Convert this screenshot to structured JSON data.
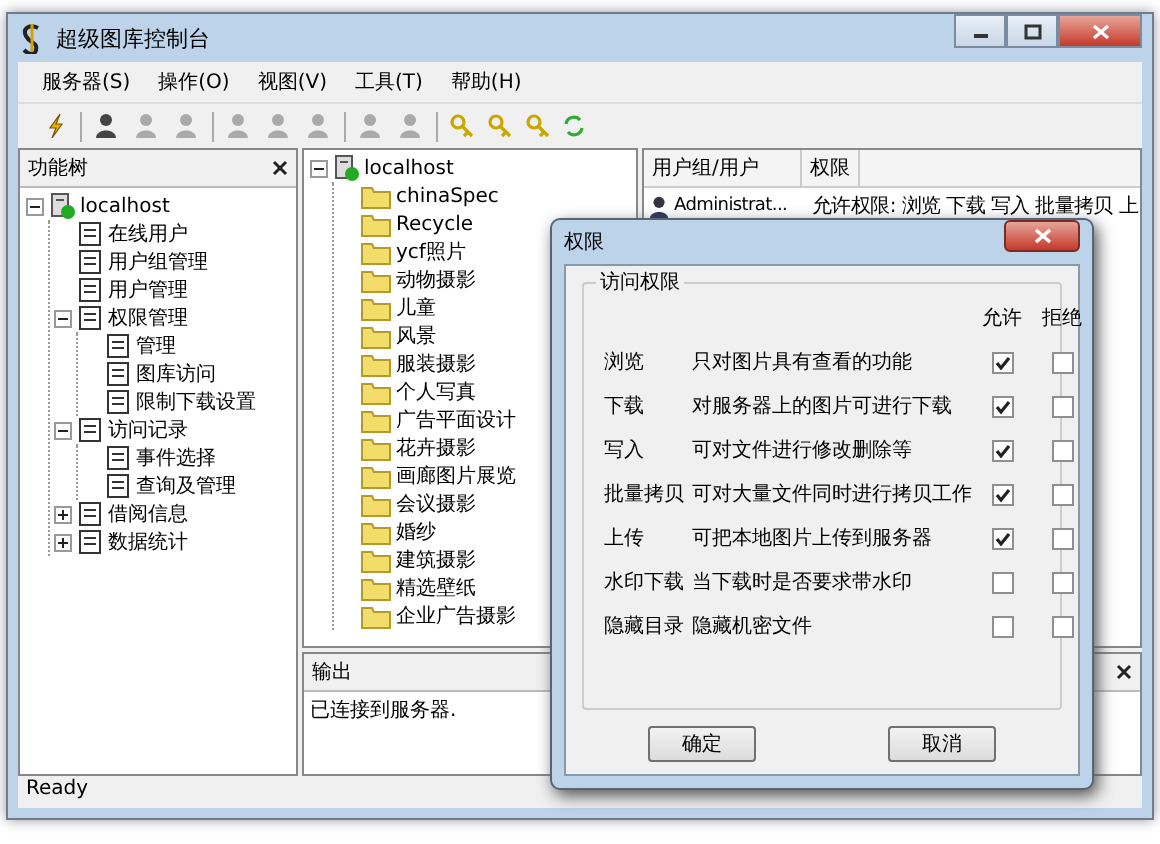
{
  "window": {
    "title": "超级图库控制台"
  },
  "menu": [
    "服务器(S)",
    "操作(O)",
    "视图(V)",
    "工具(T)",
    "帮助(H)"
  ],
  "left_pane": {
    "title": "功能树",
    "tree": [
      {
        "label": "localhost",
        "kind": "server",
        "expanded": true,
        "children": [
          {
            "label": "在线用户",
            "kind": "item"
          },
          {
            "label": "用户组管理",
            "kind": "item"
          },
          {
            "label": "用户管理",
            "kind": "item"
          },
          {
            "label": "权限管理",
            "kind": "item",
            "expanded": true,
            "children": [
              {
                "label": "管理",
                "kind": "item"
              },
              {
                "label": "图库访问",
                "kind": "item"
              },
              {
                "label": "限制下载设置",
                "kind": "item"
              }
            ]
          },
          {
            "label": "访问记录",
            "kind": "item",
            "expanded": true,
            "children": [
              {
                "label": "事件选择",
                "kind": "item"
              },
              {
                "label": "查询及管理",
                "kind": "item"
              }
            ]
          },
          {
            "label": "借阅信息",
            "kind": "item",
            "expanded": false
          },
          {
            "label": "数据统计",
            "kind": "item",
            "expanded": false
          }
        ]
      }
    ]
  },
  "folder_tree": [
    {
      "label": "localhost",
      "kind": "server",
      "expanded": true,
      "children": [
        {
          "label": "chinaSpec",
          "kind": "folder"
        },
        {
          "label": "Recycle",
          "kind": "folder"
        },
        {
          "label": "ycf照片",
          "kind": "folder"
        },
        {
          "label": "动物摄影",
          "kind": "folder"
        },
        {
          "label": "儿童",
          "kind": "folder"
        },
        {
          "label": "风景",
          "kind": "folder"
        },
        {
          "label": "服装摄影",
          "kind": "folder"
        },
        {
          "label": "个人写真",
          "kind": "folder"
        },
        {
          "label": "广告平面设计",
          "kind": "folder"
        },
        {
          "label": "花卉摄影",
          "kind": "folder"
        },
        {
          "label": "画廊图片展览",
          "kind": "folder"
        },
        {
          "label": "会议摄影",
          "kind": "folder"
        },
        {
          "label": "婚纱",
          "kind": "folder"
        },
        {
          "label": "建筑摄影",
          "kind": "folder"
        },
        {
          "label": "精选壁纸",
          "kind": "folder"
        },
        {
          "label": "企业广告摄影",
          "kind": "folder"
        }
      ]
    }
  ],
  "permission_list": {
    "columns": [
      "用户组/用户",
      "权限"
    ],
    "rows": [
      {
        "user": "Administrat...",
        "permissions": "允许权限: 浏览 下载 写入 批量拷贝 上"
      }
    ]
  },
  "output": {
    "title": "输出",
    "lines": [
      "已连接到服务器."
    ]
  },
  "status_bar": "Ready",
  "dialog": {
    "title": "权限",
    "group": "访问权限",
    "headers": [
      "允许",
      "拒绝"
    ],
    "rows": [
      {
        "name": "浏览",
        "description": "只对图片具有查看的功能",
        "allow": true,
        "deny": false
      },
      {
        "name": "下载",
        "description": "对服务器上的图片可进行下载",
        "allow": true,
        "deny": false
      },
      {
        "name": "写入",
        "description": "可对文件进行修改删除等",
        "allow": true,
        "deny": false
      },
      {
        "name": "批量拷贝",
        "description": "可对大量文件同时进行拷贝工作",
        "allow": true,
        "deny": false
      },
      {
        "name": "上传",
        "description": "可把本地图片上传到服务器",
        "allow": true,
        "deny": false
      },
      {
        "name": "水印下载",
        "description": "当下载时是否要求带水印",
        "allow": false,
        "deny": false
      },
      {
        "name": "隐藏目录",
        "description": "隐藏机密文件",
        "allow": false,
        "deny": false
      }
    ],
    "buttons": [
      "确定",
      "取消"
    ]
  }
}
